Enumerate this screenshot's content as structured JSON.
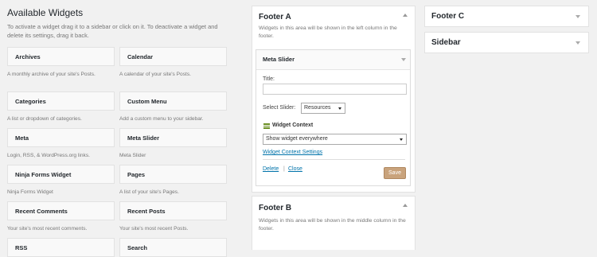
{
  "available": {
    "title": "Available Widgets",
    "description": "To activate a widget drag it to a sidebar or click on it. To deactivate a widget and delete its settings, drag it back."
  },
  "widgets": [
    {
      "title": "Archives",
      "desc": "A monthly archive of your site's Posts."
    },
    {
      "title": "Calendar",
      "desc": "A calendar of your site's Posts."
    },
    {
      "title": "Categories",
      "desc": "A list or dropdown of categories."
    },
    {
      "title": "Custom Menu",
      "desc": "Add a custom menu to your sidebar."
    },
    {
      "title": "Meta",
      "desc": "Login, RSS, & WordPress.org links."
    },
    {
      "title": "Meta Slider",
      "desc": "Meta Slider"
    },
    {
      "title": "Ninja Forms Widget",
      "desc": "Ninja Forms Widget"
    },
    {
      "title": "Pages",
      "desc": "A list of your site's Pages."
    },
    {
      "title": "Recent Comments",
      "desc": "Your site's most recent comments."
    },
    {
      "title": "Recent Posts",
      "desc": "Your site's most recent Posts."
    },
    {
      "title": "RSS",
      "desc": ""
    },
    {
      "title": "Search",
      "desc": ""
    }
  ],
  "footer_a": {
    "title": "Footer A",
    "desc": "Widgets in this area will be shown in the left column in the footer.",
    "meta_slider": {
      "title": "Meta Slider",
      "title_label": "Title:",
      "title_value": "",
      "select_slider_label": "Select Slider:",
      "select_slider_value": "Resources",
      "context_label": "Widget Context",
      "context_value": "Show widget everywhere",
      "context_settings_link": "Widget Context Settings",
      "delete_link": "Delete",
      "separator": "|",
      "close_link": "Close",
      "save_label": "Save"
    }
  },
  "footer_b": {
    "title": "Footer B",
    "desc": "Widgets in this area will be shown in the middle column in the footer."
  },
  "footer_c": {
    "title": "Footer C"
  },
  "sidebar_area": {
    "title": "Sidebar"
  },
  "colors": {
    "link": "#0073aa",
    "save_button": "#c9a37c"
  }
}
